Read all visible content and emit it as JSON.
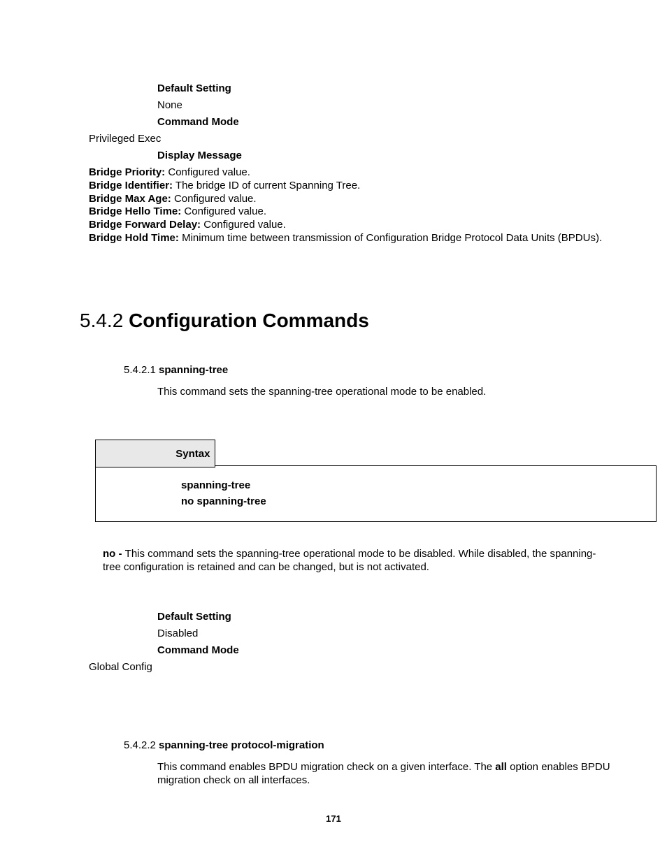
{
  "block1": {
    "default_setting_label": "Default Setting",
    "default_setting_value": "None",
    "command_mode_label": "Command Mode",
    "command_mode_value": "Privileged Exec",
    "display_message_label": "Display Message",
    "definitions": [
      {
        "term": "Bridge Priority:",
        "desc": " Configured value."
      },
      {
        "term": "Bridge Identifier:",
        "desc": " The bridge ID of current Spanning Tree."
      },
      {
        "term": "Bridge Max Age:",
        "desc": " Configured value."
      },
      {
        "term": "Bridge Hello Time:",
        "desc": " Configured value."
      },
      {
        "term": "Bridge Forward Delay:",
        "desc": " Configured value."
      },
      {
        "term": "Bridge Hold Time:",
        "desc": " Minimum time between transmission of Configuration Bridge Protocol Data Units (BPDUs)."
      }
    ]
  },
  "section": {
    "number": "5.4.2 ",
    "title": "Configuration Commands"
  },
  "sub1": {
    "number": "5.4.2.1 ",
    "title": "spanning-tree",
    "desc": "This command sets the spanning-tree operational mode to be enabled.",
    "syntax_label": "Syntax",
    "syntax_line1": "spanning-tree",
    "syntax_line2": "no spanning-tree",
    "note_bold": "no - ",
    "note_rest": "This command sets the spanning-tree operational mode to be disabled. While disabled, the spanning-tree configuration is retained and can be changed, but is not activated.",
    "default_setting_label": "Default Setting",
    "default_setting_value": "Disabled",
    "command_mode_label": "Command Mode",
    "command_mode_value": "Global Config"
  },
  "sub2": {
    "number": "5.4.2.2 ",
    "title": "spanning-tree protocol-migration",
    "desc_pre": "This command enables BPDU migration check on a given interface. The ",
    "desc_bold": "all",
    "desc_post": " option enables BPDU migration check on all interfaces."
  },
  "page_number": "171"
}
